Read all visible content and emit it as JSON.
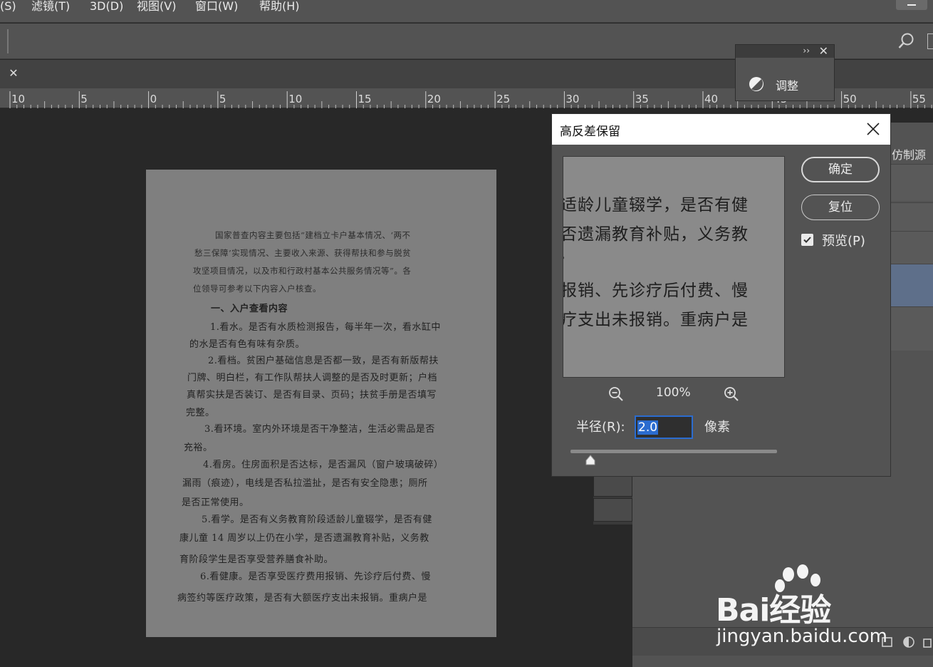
{
  "menubar": {
    "items": [
      "(S)",
      "滤镜(T)",
      "3D(D)",
      "视图(V)",
      "窗口(W)",
      "帮助(H)"
    ]
  },
  "ruler": {
    "ticks": [
      "10",
      "5",
      "0",
      "5",
      "10",
      "15",
      "20",
      "25",
      "30",
      "35",
      "40",
      "45",
      "50",
      "55"
    ]
  },
  "document": {
    "lines": [
      "国家普查内容主要包括“建档立卡户基本情况、‘两不",
      "愁三保障’实现情况、主要收入来源、获得帮扶和参与脱贫",
      "攻坚项目情况，以及市和行政村基本公共服务情况等”。各",
      "位领导可参考以下内容入户核查。",
      "一、入户查看内容",
      "1.看水。是否有水质检测报告，每半年一次，看水缸中",
      "的水是否有色有味有杂质。",
      "2.看档。贫困户基础信息是否都一致，是否有新版帮扶",
      "门牌、明白栏，有工作队帮扶人调整的是否及时更新；户档",
      "真帮实扶是否装订、是否有目录、页码；扶贫手册是否填写",
      "完整。",
      "3.看环境。室内外环境是否干净整洁，生活必需品是否",
      "充裕。",
      "4.看房。住房面积是否达标，是否漏风（窗户玻璃破碎）",
      "漏雨（痕迹），电线是否私拉滥扯，是否有安全隐患；厕所",
      "是否正常使用。",
      "5.看学。是否有义务教育阶段适龄儿童辍学，是否有健",
      "康儿童 14 周岁以上仍在小学，是否遗漏教育补贴，义务教",
      "育阶段学生是否享受营养膳食补助。",
      "6.看健康。是否享受医疗费用报销、先诊疗后付费、慢",
      "病签约等医疗政策，是否有大额医疗支出未报销。重病户是"
    ]
  },
  "adjust_panel": {
    "collapse": "››",
    "close": "✕",
    "label": "调整"
  },
  "right_panel": {
    "clone_label": "仿制源"
  },
  "dialog": {
    "title": "高反差保留",
    "preview_lines": [
      "适龄儿童辍学，是否有健",
      "否遗漏教育补贴，义务教",
      "。",
      "报销、先诊疗后付费、慢",
      "疗支出未报销。重病户是"
    ],
    "zoom_percent": "100%",
    "radius_label": "半径(R):",
    "radius_value": "2.0",
    "radius_unit": "像素",
    "ok_label": "确定",
    "reset_label": "复位",
    "preview_label": "预览(P)",
    "preview_checked": true
  },
  "watermark": {
    "brand": "Bai经验",
    "url": "jingyan.baidu.com"
  },
  "colors": {
    "menubar": "#535353",
    "canvas": "#282828",
    "dialog_bg": "#535353",
    "accent": "#2b6ccf",
    "selected_row": "#5e6f8a"
  }
}
